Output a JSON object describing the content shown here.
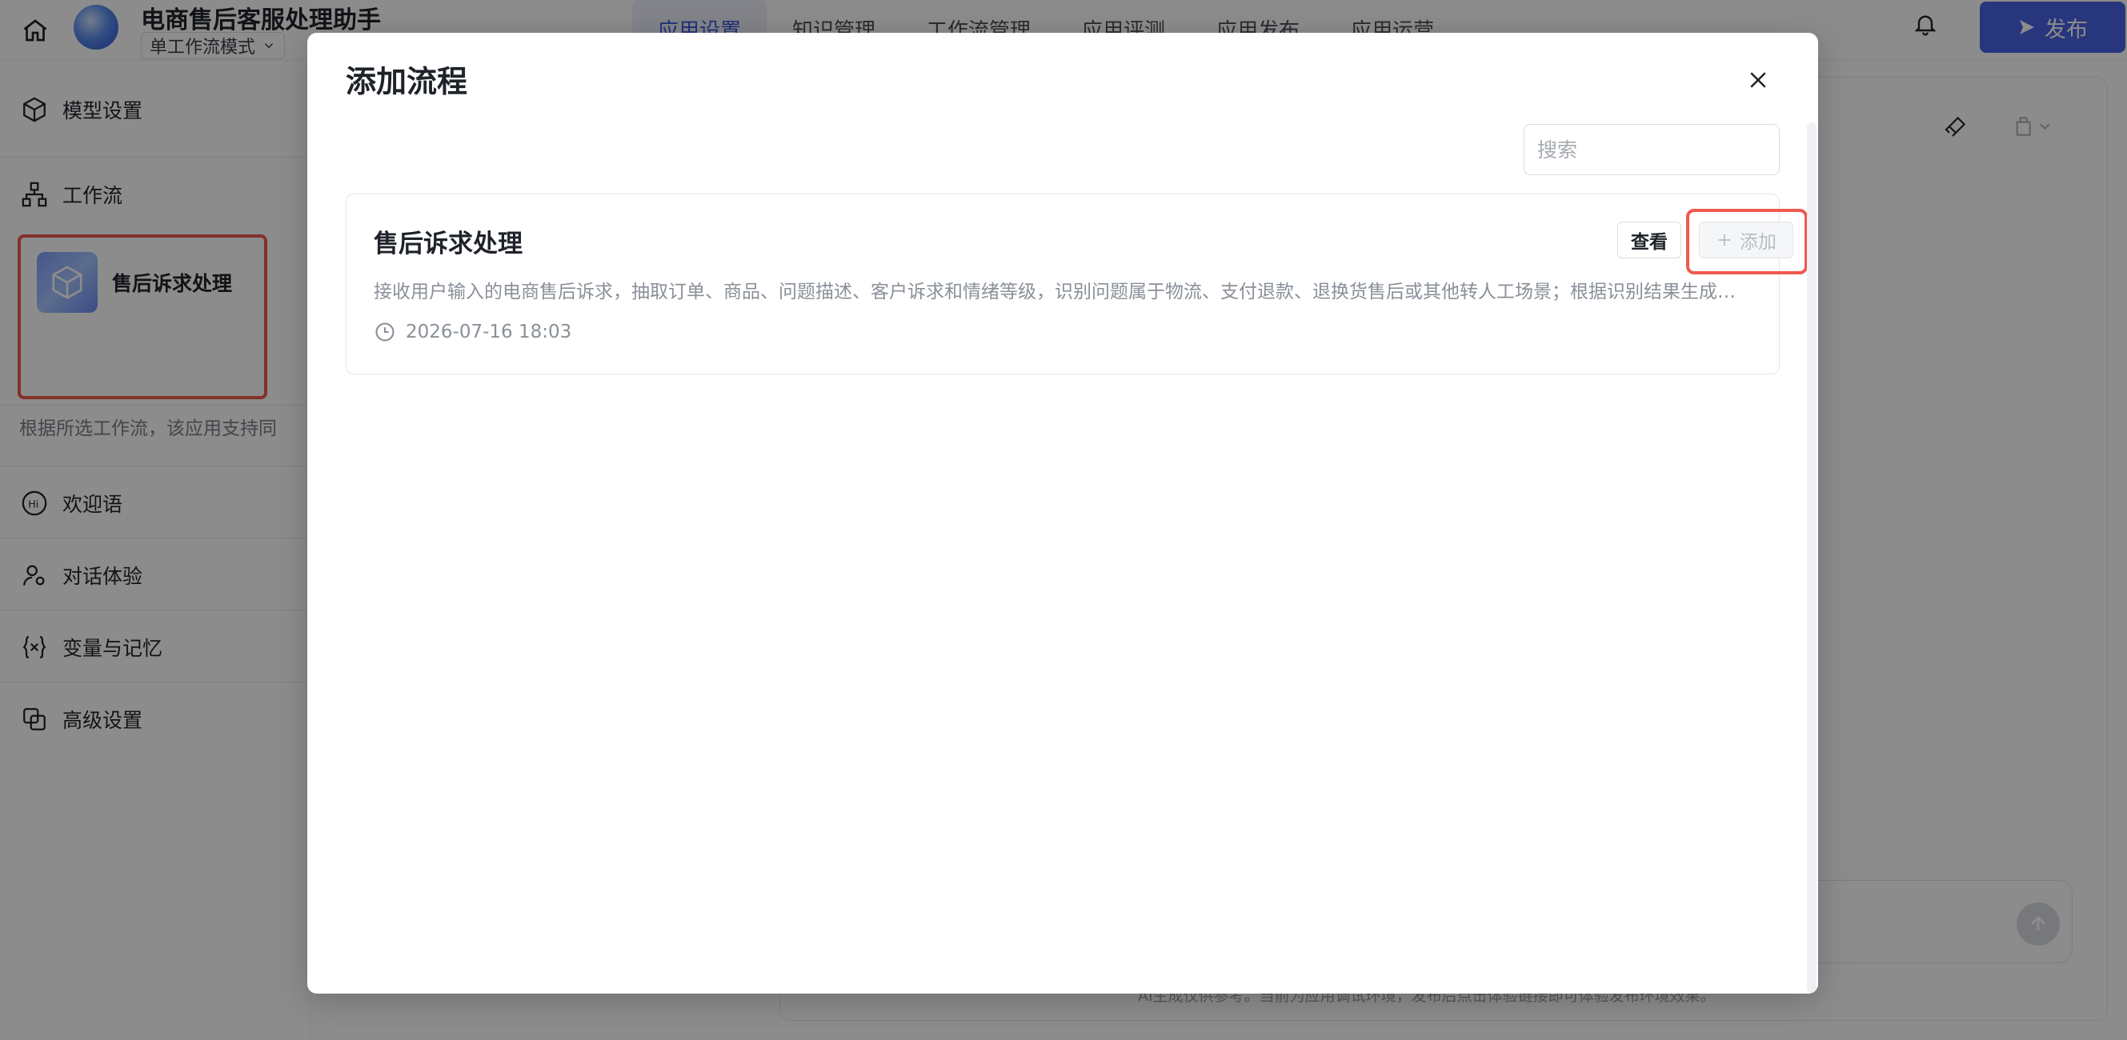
{
  "app": {
    "title": "电商售后客服处理助手",
    "mode": "单工作流模式",
    "tabs": [
      {
        "label": "应用设置"
      },
      {
        "label": "知识管理"
      },
      {
        "label": "工作流管理"
      },
      {
        "label": "应用评测"
      },
      {
        "label": "应用发布"
      },
      {
        "label": "应用运营"
      }
    ],
    "publish_label": "发布"
  },
  "sidebar": {
    "model_settings": "模型设置",
    "workflow": "工作流",
    "workflow_item": "售后诉求处理",
    "workflow_note": "根据所选工作流，该应用支持同",
    "welcome": "欢迎语",
    "chat_experience": "对话体验",
    "variables_memory": "变量与记忆",
    "advanced_settings": "高级设置"
  },
  "footer_note": "AI生成仅供参考。当前为应用调试环境，发布后点击体验链接即可体验发布环境效果。",
  "modal": {
    "title": "添加流程",
    "search_placeholder": "搜索",
    "flows": [
      {
        "name": "售后诉求处理",
        "description": "接收用户输入的电商售后诉求，抽取订单、商品、问题描述、客户诉求和情绪等级，识别问题属于物流、支付退款、退换货售后或其他转人工场景；根据识别结果生成对应的处理建议与标准回复",
        "time": "2026-07-16 18:03",
        "view_label": "查看",
        "add_label": "添加"
      }
    ]
  },
  "colors": {
    "accent": "#4a63e6",
    "highlight": "#ef5a4e"
  }
}
